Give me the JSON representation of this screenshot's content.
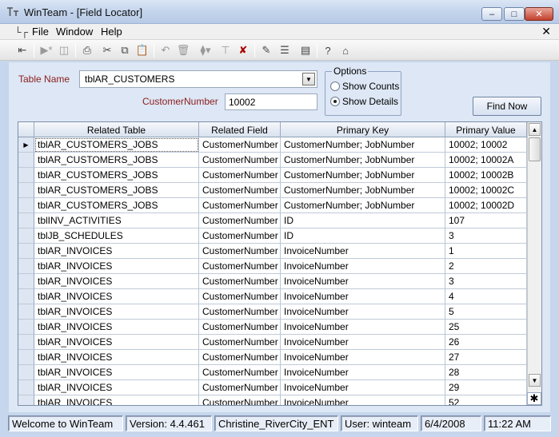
{
  "window": {
    "title": "WinTeam - [Field Locator]"
  },
  "menu": {
    "items": [
      "File",
      "Window",
      "Help"
    ]
  },
  "form": {
    "table_name_label": "Table Name",
    "table_name_value": "tblAR_CUSTOMERS",
    "field_label": "CustomerNumber",
    "field_value": "10002",
    "options_title": "Options",
    "option_counts": "Show Counts",
    "option_details": "Show Details",
    "selected_option": "Show Details",
    "find_button": "Find Now"
  },
  "grid": {
    "columns": [
      "Related Table",
      "Related Field",
      "Primary Key",
      "Primary Value"
    ],
    "rows": [
      [
        "tblAR_CUSTOMERS_JOBS",
        "CustomerNumber",
        "CustomerNumber;  JobNumber",
        "10002;  10002"
      ],
      [
        "tblAR_CUSTOMERS_JOBS",
        "CustomerNumber",
        "CustomerNumber;  JobNumber",
        "10002;  10002A"
      ],
      [
        "tblAR_CUSTOMERS_JOBS",
        "CustomerNumber",
        "CustomerNumber;  JobNumber",
        "10002;  10002B"
      ],
      [
        "tblAR_CUSTOMERS_JOBS",
        "CustomerNumber",
        "CustomerNumber;  JobNumber",
        "10002;  10002C"
      ],
      [
        "tblAR_CUSTOMERS_JOBS",
        "CustomerNumber",
        "CustomerNumber;  JobNumber",
        "10002;  10002D"
      ],
      [
        "tblINV_ACTIVITIES",
        "CustomerNumber",
        "ID",
        "107"
      ],
      [
        "tblJB_SCHEDULES",
        "CustomerNumber",
        "ID",
        "3"
      ],
      [
        "tblAR_INVOICES",
        "CustomerNumber",
        "InvoiceNumber",
        "1"
      ],
      [
        "tblAR_INVOICES",
        "CustomerNumber",
        "InvoiceNumber",
        "2"
      ],
      [
        "tblAR_INVOICES",
        "CustomerNumber",
        "InvoiceNumber",
        "3"
      ],
      [
        "tblAR_INVOICES",
        "CustomerNumber",
        "InvoiceNumber",
        "4"
      ],
      [
        "tblAR_INVOICES",
        "CustomerNumber",
        "InvoiceNumber",
        "5"
      ],
      [
        "tblAR_INVOICES",
        "CustomerNumber",
        "InvoiceNumber",
        "25"
      ],
      [
        "tblAR_INVOICES",
        "CustomerNumber",
        "InvoiceNumber",
        "26"
      ],
      [
        "tblAR_INVOICES",
        "CustomerNumber",
        "InvoiceNumber",
        "27"
      ],
      [
        "tblAR_INVOICES",
        "CustomerNumber",
        "InvoiceNumber",
        "28"
      ],
      [
        "tblAR_INVOICES",
        "CustomerNumber",
        "InvoiceNumber",
        "29"
      ],
      [
        "tblAR_INVOICES",
        "CustomerNumber",
        "InvoiceNumber",
        "52"
      ]
    ],
    "current_row": 0
  },
  "status": {
    "welcome": "Welcome to WinTeam",
    "version": "Version: 4.4.461",
    "company": "Christine_RiverCity_ENT",
    "user": "User: winteam",
    "date": "6/4/2008",
    "time": "11:22 AM"
  },
  "toolbar_icons": [
    "exit-icon",
    "record-nav-icon",
    "save-copy-icon",
    "print-icon",
    "cut-icon",
    "copy-icon",
    "paste-icon",
    "undo-icon",
    "delete-icon",
    "filter-icon",
    "filter-clear-icon",
    "remove-filter-icon",
    "edit-notes-icon",
    "list-icon",
    "report-icon",
    "help-icon",
    "home-icon"
  ]
}
